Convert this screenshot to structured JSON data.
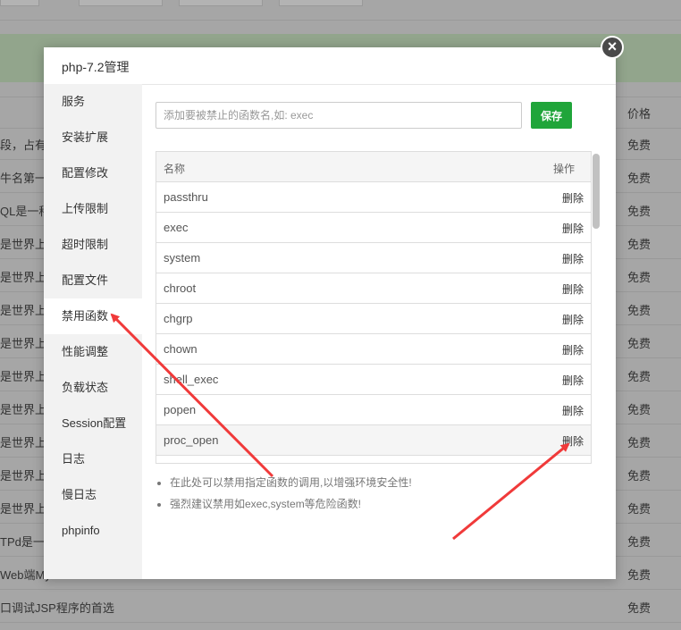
{
  "background": {
    "price_header": "价格",
    "rows": [
      {
        "left": "段，占有内",
        "price": "免费"
      },
      {
        "left": "牛名第一，",
        "price": "免费"
      },
      {
        "left": "QL是一种关",
        "price": "免费"
      },
      {
        "left": "是世界上最",
        "price": "免费"
      },
      {
        "left": "是世界上最",
        "price": "免费"
      },
      {
        "left": "是世界上最",
        "price": "免费"
      },
      {
        "left": "是世界上最",
        "price": "免费"
      },
      {
        "left": "是世界上最",
        "price": "免费"
      },
      {
        "left": "是世界上最",
        "price": "免费"
      },
      {
        "left": "是世界上最",
        "price": "免费"
      },
      {
        "left": "是世界上最",
        "price": "免费"
      },
      {
        "left": "是世界上最",
        "price": "免费"
      },
      {
        "left": "TPd是一款",
        "price": "免费"
      },
      {
        "left": "Web端My",
        "price": "免费"
      },
      {
        "left": "口调试JSP程序的首选",
        "price": "免费"
      }
    ]
  },
  "dialog": {
    "title": "php-7.2管理",
    "close_symbol": "×",
    "sidebar": [
      {
        "label": "服务"
      },
      {
        "label": "安装扩展"
      },
      {
        "label": "配置修改"
      },
      {
        "label": "上传限制"
      },
      {
        "label": "超时限制"
      },
      {
        "label": "配置文件"
      },
      {
        "label": "禁用函数",
        "active": true
      },
      {
        "label": "性能调整"
      },
      {
        "label": "负载状态"
      },
      {
        "label": "Session配置"
      },
      {
        "label": "日志"
      },
      {
        "label": "慢日志"
      },
      {
        "label": "phpinfo"
      }
    ],
    "input_placeholder": "添加要被禁止的函数名,如: exec",
    "save_label": "保存",
    "table": {
      "col_name": "名称",
      "col_op": "操作",
      "rows": [
        {
          "name": "passthru",
          "action": "删除"
        },
        {
          "name": "exec",
          "action": "删除"
        },
        {
          "name": "system",
          "action": "删除"
        },
        {
          "name": "chroot",
          "action": "删除"
        },
        {
          "name": "chgrp",
          "action": "删除"
        },
        {
          "name": "chown",
          "action": "删除"
        },
        {
          "name": "shell_exec",
          "action": "删除"
        },
        {
          "name": "popen",
          "action": "删除"
        },
        {
          "name": "proc_open",
          "action": "删除"
        }
      ]
    },
    "tips": [
      "在此处可以禁用指定函数的调用,以增强环境安全性!",
      "强烈建议禁用如exec,system等危险函数!"
    ]
  },
  "colors": {
    "accent_green": "#20a53a",
    "annotation_red": "#f03a3a"
  }
}
